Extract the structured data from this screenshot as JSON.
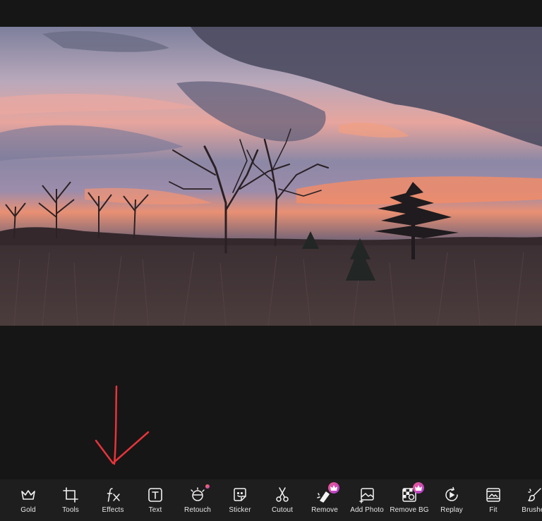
{
  "toolbar": {
    "items": [
      {
        "label": "Gold",
        "icon": "crown-icon",
        "badge": "none"
      },
      {
        "label": "Tools",
        "icon": "crop-icon",
        "badge": "none"
      },
      {
        "label": "Effects",
        "icon": "fx-icon",
        "badge": "none"
      },
      {
        "label": "Text",
        "icon": "text-icon",
        "badge": "none"
      },
      {
        "label": "Retouch",
        "icon": "retouch-icon",
        "badge": "new-dot"
      },
      {
        "label": "Sticker",
        "icon": "sticker-icon",
        "badge": "none"
      },
      {
        "label": "Cutout",
        "icon": "scissors-icon",
        "badge": "none"
      },
      {
        "label": "Remove",
        "icon": "magic-eraser-icon",
        "badge": "premium-crown"
      },
      {
        "label": "Add Photo",
        "icon": "add-photo-icon",
        "badge": "none"
      },
      {
        "label": "Remove BG",
        "icon": "remove-bg-icon",
        "badge": "premium-crown"
      },
      {
        "label": "Replay",
        "icon": "replay-icon",
        "badge": "none"
      },
      {
        "label": "Fit",
        "icon": "fit-icon",
        "badge": "none"
      },
      {
        "label": "Brushes",
        "icon": "brush-icon",
        "badge": "none"
      }
    ]
  },
  "colors": {
    "background": "#161616",
    "toolbar_background": "#1e1e1e",
    "icon_color": "#f2f2f2",
    "label_color": "#e6e6e6",
    "annotation_arrow": "#e8333a",
    "premium_badge": "#c04ad0"
  }
}
